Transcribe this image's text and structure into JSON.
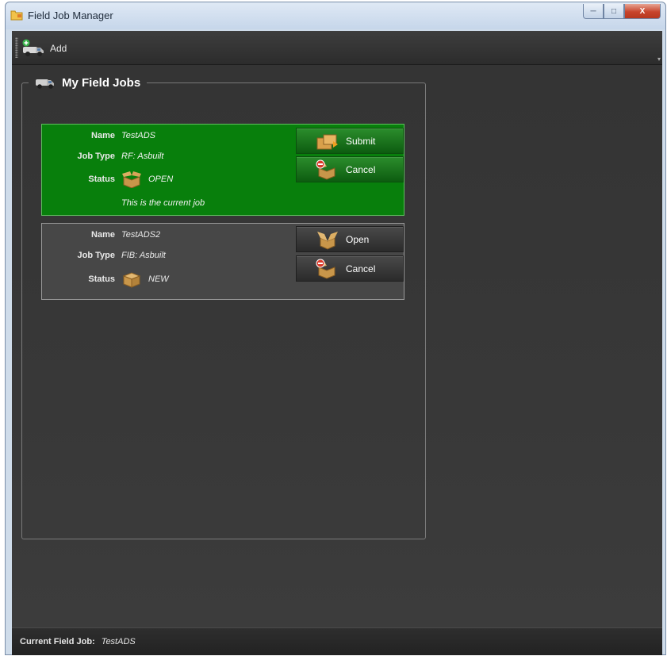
{
  "window": {
    "title": "Field Job Manager",
    "controls": {
      "minimize": "─",
      "maximize": "□",
      "close": "X"
    }
  },
  "toolbar": {
    "add_label": "Add",
    "add_icon": "truck-add-icon"
  },
  "group": {
    "title": "My Field Jobs",
    "icon": "truck-icon"
  },
  "jobs": [
    {
      "labels": {
        "name": "Name",
        "job_type": "Job Type",
        "status": "Status"
      },
      "name": "TestADS",
      "job_type": "RF: Asbuilt",
      "status": "OPEN",
      "status_icon": "open-box-icon",
      "note": "This is the current job",
      "is_current": true,
      "buttons": [
        {
          "label": "Submit",
          "icon": "submit-package-icon"
        },
        {
          "label": "Cancel",
          "icon": "cancel-package-icon"
        }
      ]
    },
    {
      "labels": {
        "name": "Name",
        "job_type": "Job Type",
        "status": "Status"
      },
      "name": "TestADS2",
      "job_type": "FIB: Asbuilt",
      "status": "NEW",
      "status_icon": "closed-box-icon",
      "note": "",
      "is_current": false,
      "buttons": [
        {
          "label": "Open",
          "icon": "open-package-icon"
        },
        {
          "label": "Cancel",
          "icon": "cancel-package-icon"
        }
      ]
    }
  ],
  "statusbar": {
    "label": "Current Field Job:",
    "value": "TestADS"
  },
  "colors": {
    "current_job_bg": "#087f0c",
    "other_job_bg": "#474747",
    "client_bg": "#353535",
    "titlebar": "#cfdcea",
    "close_button": "#c8452c"
  }
}
